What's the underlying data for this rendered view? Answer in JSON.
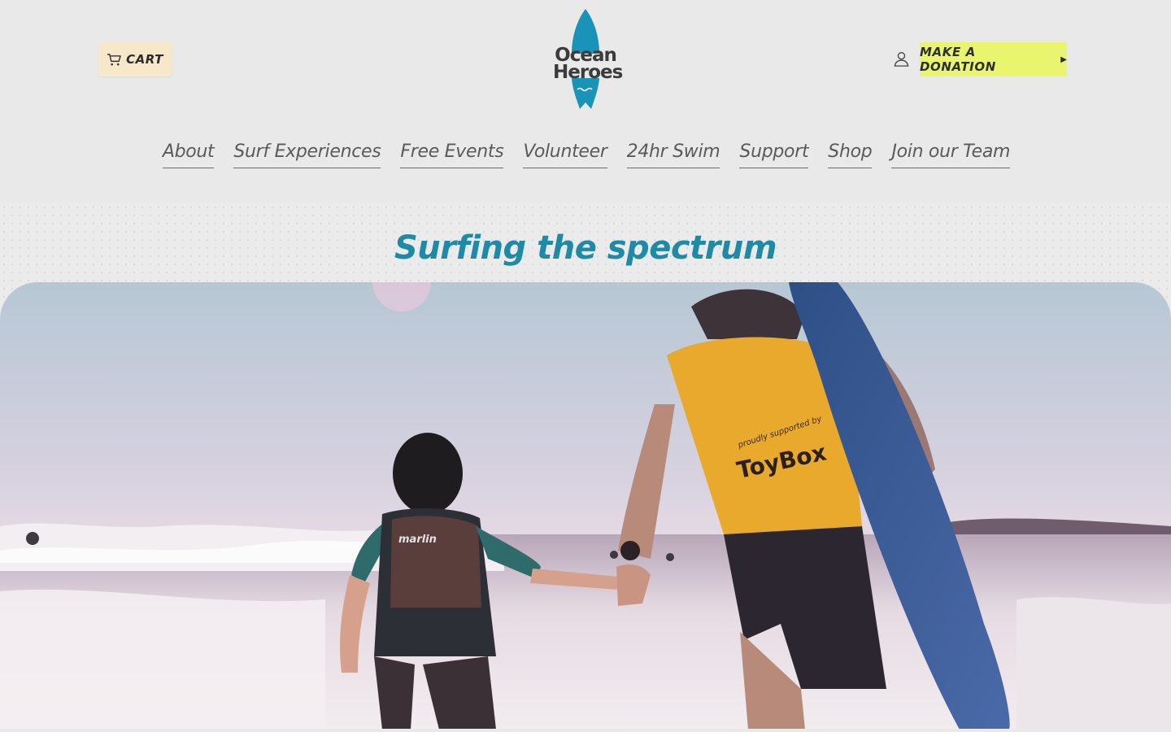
{
  "header": {
    "cart_label": "CART",
    "logo_line1": "Ocean",
    "logo_line2": "Heroes",
    "donate_label": "MAKE A DONATION",
    "colors": {
      "cart_bg": "#f6e8c8",
      "donate_bg": "#e9f56d",
      "logo_blue": "#1a93b8"
    },
    "icons": [
      "cart-icon",
      "account-icon",
      "chevron-right-icon"
    ]
  },
  "nav": {
    "items": [
      {
        "label": "About"
      },
      {
        "label": "Surf Experiences"
      },
      {
        "label": "Free Events"
      },
      {
        "label": "Volunteer"
      },
      {
        "label": "24hr Swim"
      },
      {
        "label": "Support"
      },
      {
        "label": "Shop"
      },
      {
        "label": "Join our Team"
      }
    ]
  },
  "hero": {
    "title": "Surfing the spectrum",
    "title_color": "#1f8aa7",
    "shirt_text": "proudly supported by",
    "shirt_brand": "ToyBox",
    "vest_text": "marlin"
  }
}
